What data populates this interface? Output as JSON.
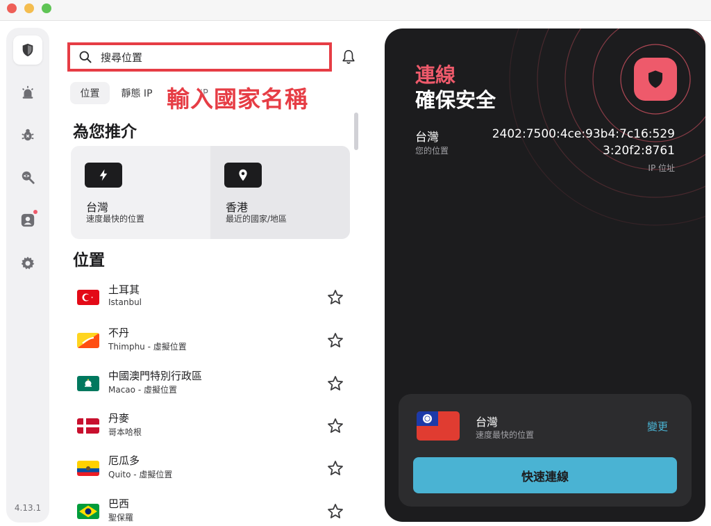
{
  "app": {
    "version": "4.13.1"
  },
  "window": {
    "controls": [
      "close",
      "minimize",
      "zoom"
    ]
  },
  "sidebar": {
    "items": [
      {
        "icon": "shield-icon",
        "active": true
      },
      {
        "icon": "alarm-icon",
        "active": false
      },
      {
        "icon": "bug-icon",
        "active": false
      },
      {
        "icon": "search-eye-icon",
        "active": false
      },
      {
        "icon": "account-icon",
        "active": false,
        "notification": true
      },
      {
        "icon": "gear-icon",
        "active": false
      }
    ]
  },
  "search": {
    "placeholder": "搜尋位置"
  },
  "tabs": [
    {
      "label": "位置",
      "active": true
    },
    {
      "label": "靜態 IP",
      "active": false
    },
    {
      "label": "IP",
      "active": false
    }
  ],
  "annotation": "輸入國家名稱",
  "recommended": {
    "title": "為您推介",
    "cards": [
      {
        "icon": "bolt-icon",
        "name": "台灣",
        "sub": "速度最快的位置"
      },
      {
        "icon": "location-pin-icon",
        "name": "香港",
        "sub": "最近的國家/地區"
      }
    ]
  },
  "locations": {
    "title": "位置",
    "items": [
      {
        "flag": "turkey",
        "name": "土耳其",
        "sub": "Istanbul"
      },
      {
        "flag": "bhutan",
        "name": "不丹",
        "sub": "Thimphu - 虛擬位置"
      },
      {
        "flag": "macao",
        "name": "中國澳門特別行政區",
        "sub": "Macao - 虛擬位置"
      },
      {
        "flag": "denmark",
        "name": "丹麥",
        "sub": "哥本哈根"
      },
      {
        "flag": "ecuador",
        "name": "厄瓜多",
        "sub": "Quito - 虛擬位置"
      },
      {
        "flag": "brazil",
        "name": "巴西",
        "sub": "聖保羅"
      }
    ]
  },
  "status": {
    "title": "連線",
    "subtitle": "確保安全",
    "location": "台灣",
    "location_caption": "您的位置",
    "ip": "2402:7500:4ce:93b4:7c16:529\n3:20f2:8761",
    "ip_caption": "IP 位址"
  },
  "connect_card": {
    "flag": "taiwan",
    "name": "台灣",
    "sub": "速度最快的位置",
    "change": "變更",
    "quick_connect": "快速連線"
  },
  "colors": {
    "accent_red": "#ee5a6b",
    "accent_blue": "#4ab3d3",
    "dark_panel": "#1c1c1e",
    "annotation_red": "#e63d45"
  }
}
